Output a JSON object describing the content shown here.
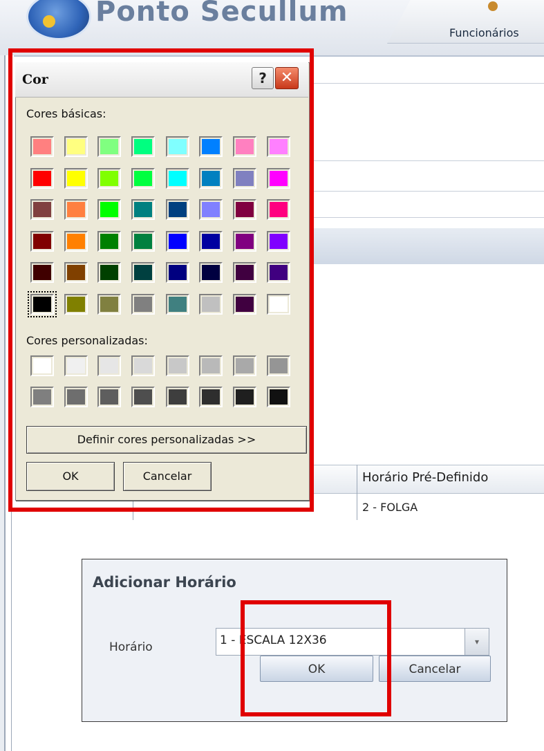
{
  "app": {
    "title": "Ponto Secullum",
    "tab_label": "Funcionários"
  },
  "grid": {
    "header_label": "Horário Pré-Definido",
    "row_value": "2 - FOLGA"
  },
  "cor_dialog": {
    "title": "Cor",
    "help_symbol": "?",
    "close_symbol": "✕",
    "basic_label": "Cores básicas:",
    "custom_label": "Cores personalizadas:",
    "define_button": "Definir cores personalizadas >>",
    "ok_button": "OK",
    "cancel_button": "Cancelar",
    "basic_colors": [
      [
        "#ff8080",
        "#ffff80",
        "#80ff80",
        "#00ff80",
        "#80ffff",
        "#0080ff",
        "#ff80c0",
        "#ff80ff"
      ],
      [
        "#ff0000",
        "#ffff00",
        "#80ff00",
        "#00ff40",
        "#00ffff",
        "#0080c0",
        "#8080c0",
        "#ff00ff"
      ],
      [
        "#804040",
        "#ff8040",
        "#00ff00",
        "#008080",
        "#004080",
        "#8080ff",
        "#800040",
        "#ff0080"
      ],
      [
        "#800000",
        "#ff8000",
        "#008000",
        "#008040",
        "#0000ff",
        "#0000a0",
        "#800080",
        "#8000ff"
      ],
      [
        "#400000",
        "#804000",
        "#004000",
        "#004040",
        "#000080",
        "#000040",
        "#400040",
        "#400080"
      ],
      [
        "#000000",
        "#808000",
        "#808040",
        "#808080",
        "#408080",
        "#c0c0c0",
        "#400040",
        "#ffffff"
      ]
    ],
    "custom_colors": [
      [
        "#ffffff",
        "#f0f0f0",
        "#e6e6e6",
        "#d9d9d9",
        "#c8c8c8",
        "#b9b9b9",
        "#a9a9a9",
        "#959595"
      ],
      [
        "#7f7f7f",
        "#6e6e6e",
        "#5e5e5e",
        "#4e4e4e",
        "#3e3e3e",
        "#2e2e2e",
        "#1f1f1f",
        "#111111"
      ]
    ]
  },
  "add_dialog": {
    "title": "Adicionar Horário",
    "field_label": "Horário",
    "selected_value": "1 - ESCALA 12X36",
    "dropdown_arrow": "▾",
    "ok_button": "OK",
    "cancel_button": "Cancelar"
  }
}
